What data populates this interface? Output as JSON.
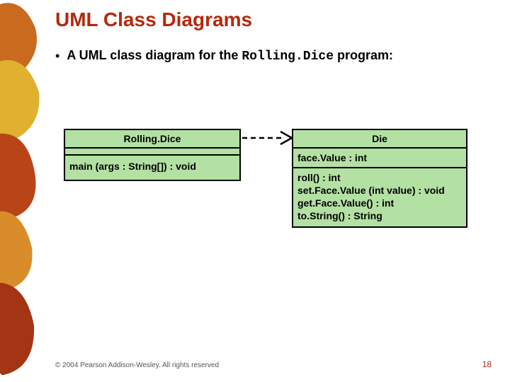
{
  "title": "UML Class Diagrams",
  "bullet": {
    "pre": "A UML class diagram for the ",
    "mono": "Rolling.Dice",
    "post": " program:"
  },
  "left": {
    "name": "Rolling.Dice",
    "ops": [
      "main (args : String[]) : void"
    ]
  },
  "right": {
    "name": "Die",
    "attrs": [
      "face.Value : int"
    ],
    "ops": [
      "roll() : int",
      "set.Face.Value (int value) : void",
      "get.Face.Value() : int",
      "to.String() : String"
    ]
  },
  "footer": "© 2004 Pearson Addison-Wesley. All rights reserved",
  "page": "18"
}
